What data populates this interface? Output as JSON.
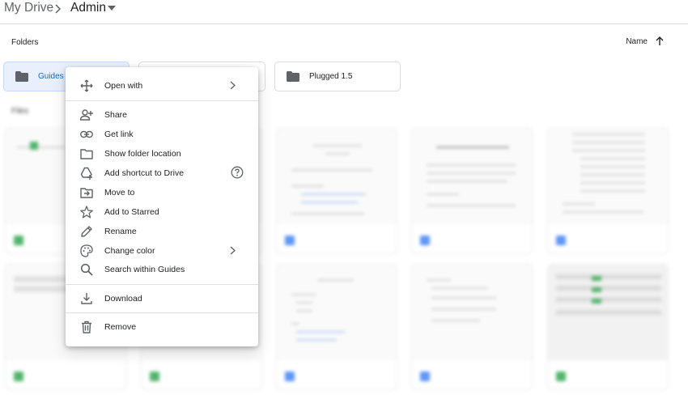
{
  "breadcrumb": {
    "root": "My Drive",
    "current": "Admin"
  },
  "folders_label": "Folders",
  "sort": {
    "label": "Name",
    "direction": "ascending"
  },
  "folders": [
    {
      "name": "Guides",
      "selected": true
    },
    {
      "name": "",
      "selected": false
    },
    {
      "name": "Plugged 1.5",
      "selected": false
    }
  ],
  "files_label": "Files",
  "context_menu": {
    "open_with": "Open with",
    "share": "Share",
    "get_link": "Get link",
    "show_folder_location": "Show folder location",
    "add_shortcut": "Add shortcut to Drive",
    "move_to": "Move to",
    "add_to_starred": "Add to Starred",
    "rename": "Rename",
    "change_color": "Change color",
    "search_within": "Search within Guides",
    "download": "Download",
    "remove": "Remove"
  },
  "colors": {
    "accent": "#1967d2",
    "selected_bg": "#e8f0fe",
    "icon": "#5f6368",
    "sheets": "#34a853",
    "docs": "#4285f4"
  }
}
